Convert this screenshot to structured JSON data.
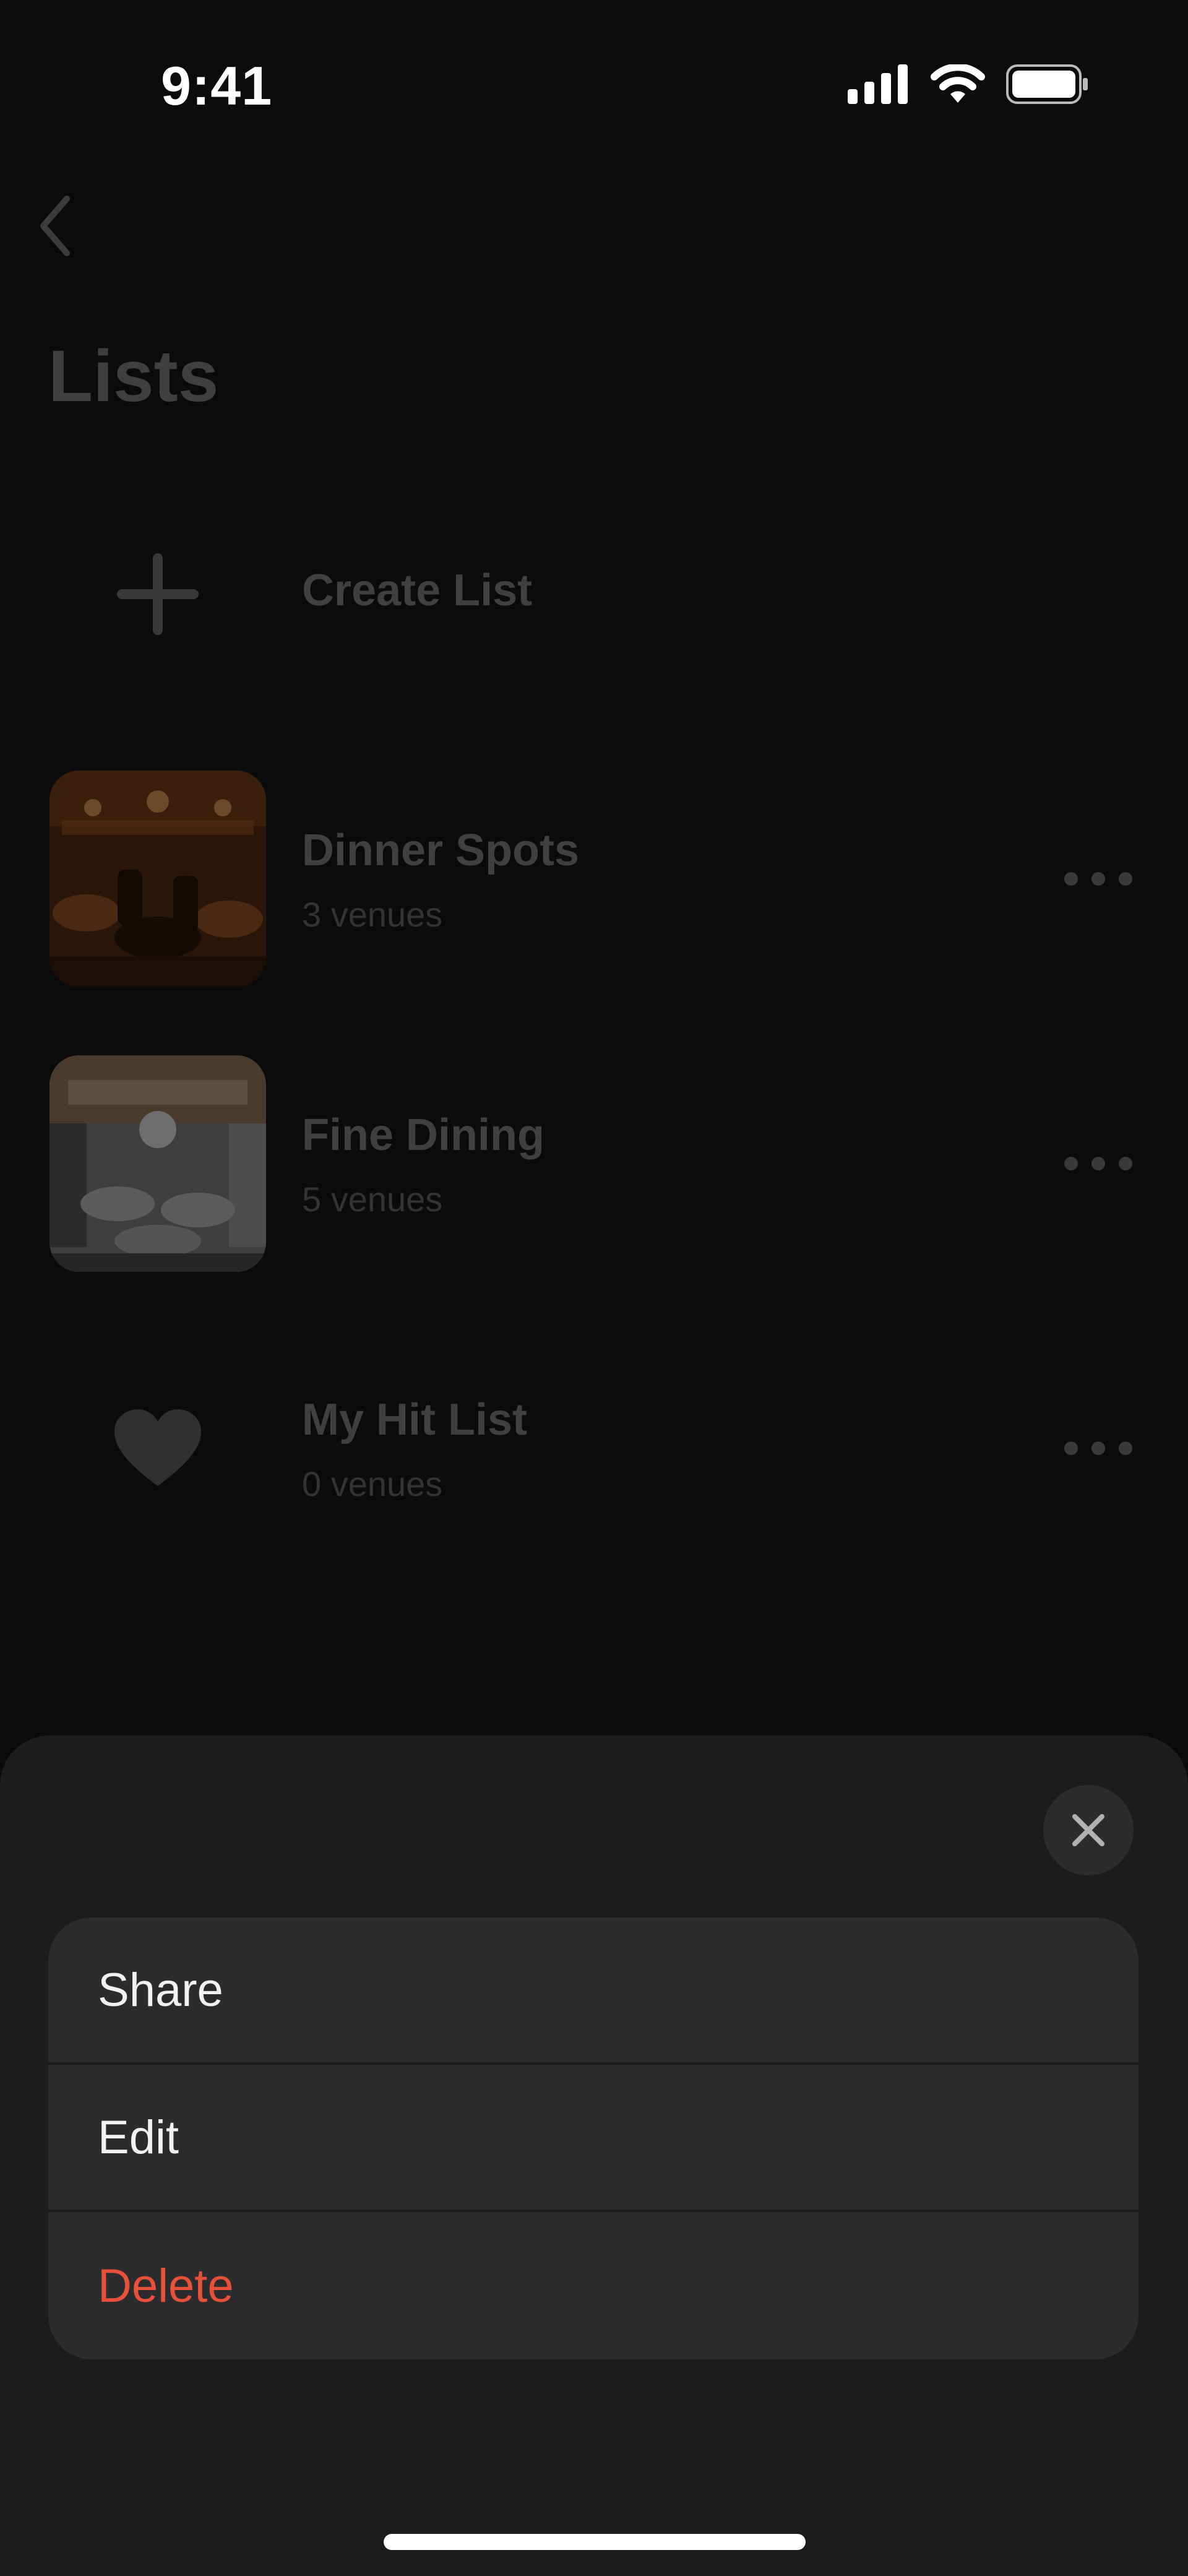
{
  "status_bar": {
    "time": "9:41",
    "icons": [
      "signal-icon",
      "wifi-icon",
      "battery-icon"
    ]
  },
  "header": {
    "back_icon": "chevron-left-icon",
    "title": "Lists"
  },
  "create_list": {
    "icon": "plus-icon",
    "label": "Create List"
  },
  "lists": [
    {
      "name": "Dinner Spots",
      "count": "3 venues",
      "thumbnail": "restaurant-photo-warm"
    },
    {
      "name": "Fine Dining",
      "count": "5 venues",
      "thumbnail": "restaurant-photo-white"
    },
    {
      "name": "My Hit List",
      "count": "0 venues",
      "thumbnail": "heart-icon"
    }
  ],
  "sheet": {
    "close_icon": "close-icon",
    "actions": [
      {
        "label": "Share",
        "style": "default"
      },
      {
        "label": "Edit",
        "style": "default"
      },
      {
        "label": "Delete",
        "style": "destructive"
      }
    ]
  },
  "colors": {
    "background": "#0b0b0c",
    "sheet": "#1c1c1e",
    "menu": "#2c2c2e",
    "destructive": "#e8503a"
  }
}
